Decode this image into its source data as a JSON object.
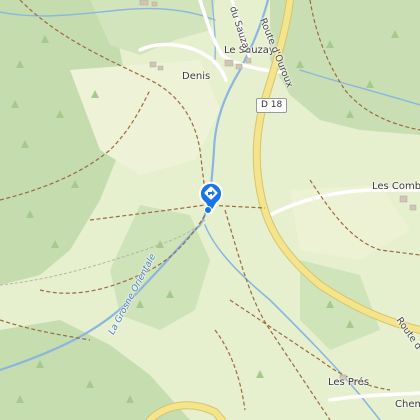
{
  "places": {
    "denis": "Denis",
    "le_sauzay": "Le Sauzay",
    "les_combes": "Les Comb",
    "les_pres": "Les Prés",
    "chemin_partial": "Chem"
  },
  "roads": {
    "d18": "D 18",
    "route_d_ouroux_1": "Route d'Ouroux",
    "route_d_ouroux_2": "Route d",
    "du_sauzay": "du Sauzay"
  },
  "rivers": {
    "grosne_orientale": "La Grosne Orientale"
  },
  "marker": {
    "icon": "navigation-pin-icon",
    "color": "#1a73e8"
  },
  "colors": {
    "meadow": "#e6f0cf",
    "forest": "#c4dcae",
    "road_major": "#f4e48c",
    "river": "#8bb6dd",
    "trail": "#9b6b3e"
  }
}
